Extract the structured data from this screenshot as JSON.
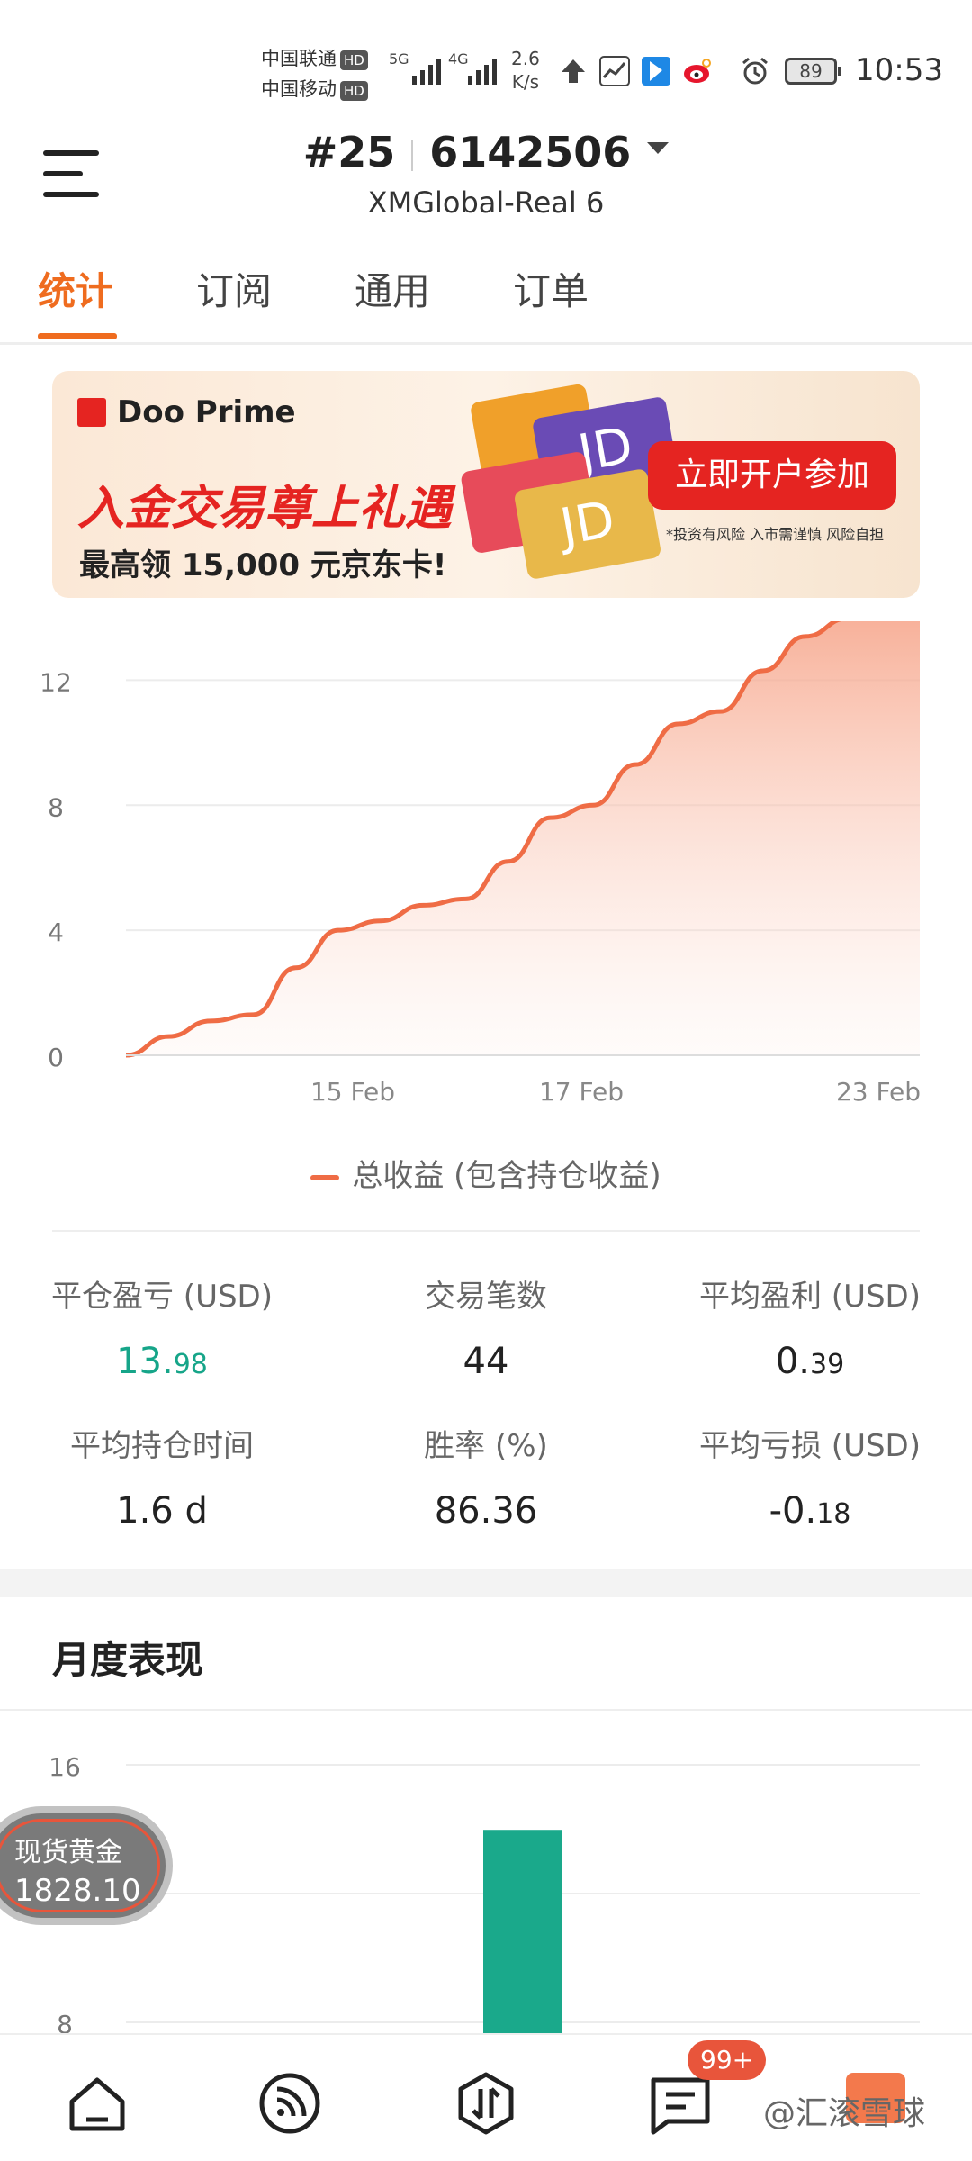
{
  "status_bar": {
    "carrier1": "中国联通",
    "carrier2": "中国移动",
    "hd": "HD",
    "net1": "5G",
    "net2": "4G",
    "speed_value": "2.6",
    "speed_unit": "K/s",
    "battery": "89",
    "time": "10:53"
  },
  "header": {
    "account_index": "#25",
    "account_number": "6142506",
    "server": "XMGlobal-Real 6"
  },
  "tabs": [
    {
      "label": "统计",
      "active": true
    },
    {
      "label": "订阅",
      "active": false
    },
    {
      "label": "通用",
      "active": false
    },
    {
      "label": "订单",
      "active": false
    }
  ],
  "banner": {
    "brand": "Doo Prime",
    "headline": "入金交易尊上礼遇",
    "subline": "最高领 15,000 元京东卡!",
    "cta": "立即开户参加",
    "risk_note": "*投资有风险 入市需谨慎 风险自担",
    "card_text": "JD"
  },
  "chart_data": [
    {
      "type": "area",
      "x": [
        "15 Feb",
        "17 Feb",
        "23 Feb"
      ],
      "x_ticks": [
        "15 Feb",
        "17 Feb",
        "23 Feb"
      ],
      "y_ticks": [
        "0",
        "4",
        "8",
        "12"
      ],
      "ylim": [
        0,
        14
      ],
      "series": [
        {
          "name": "总收益 (包含持仓收益)",
          "color": "#ef6c45",
          "values": [
            0.0,
            0.6,
            1.1,
            1.3,
            2.8,
            4.0,
            4.3,
            4.8,
            5.0,
            6.2,
            7.6,
            8.0,
            9.3,
            10.6,
            11.0,
            12.3,
            13.4,
            13.98
          ]
        }
      ]
    },
    {
      "type": "bar",
      "y_ticks": [
        "8",
        "12",
        "16"
      ],
      "ylim": [
        8,
        16
      ],
      "series": [
        {
          "color": "#1aa98b",
          "values": [
            13.98
          ]
        }
      ]
    }
  ],
  "stats": {
    "closed_pl": {
      "label": "平仓盈亏 (USD)",
      "int": "13.",
      "dec": "98"
    },
    "trade_count": {
      "label": "交易笔数",
      "value": "44"
    },
    "avg_profit": {
      "label": "平均盈利 (USD)",
      "int": "0.",
      "dec": "39"
    },
    "avg_hold": {
      "label": "平均持仓时间",
      "value": "1.6 d"
    },
    "win_rate": {
      "label": "胜率 (%)",
      "value": "86.36"
    },
    "avg_loss": {
      "label": "平均亏损 (USD)",
      "int": "-0.",
      "dec": "18"
    }
  },
  "monthly": {
    "title": "月度表现"
  },
  "ticker": {
    "name": "现货黄金",
    "price": "1828.10"
  },
  "bottom_nav": {
    "badge": "99+",
    "watermark": "@汇滚雪球"
  },
  "colors": {
    "accent": "#ef6c1f",
    "green": "#16a589",
    "line": "#ef6c45"
  }
}
